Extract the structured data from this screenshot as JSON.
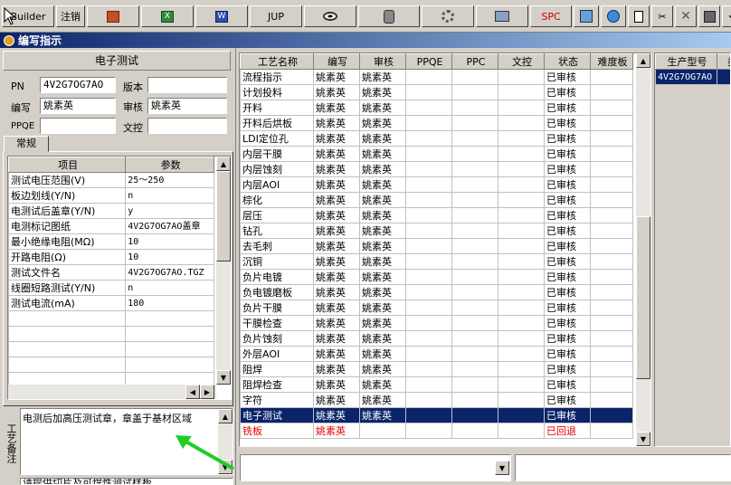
{
  "toolbar": {
    "builder_label": "Builder",
    "logout_label": "注销",
    "jup_label": "JUP",
    "spc_label": "SPC"
  },
  "window": {
    "title": "编写指示"
  },
  "left": {
    "panel_title": "电子测试",
    "pn_label": "PN",
    "pn_value": "4V2G7OG7AO",
    "version_label": "版本",
    "version_value": "",
    "author_label": "编写",
    "author_value": "姚素英",
    "reviewer_label": "审核",
    "reviewer_value": "姚素英",
    "ppqe_label": "PPQE",
    "ppqe_value": "",
    "doc_label": "文控",
    "doc_value": "",
    "tab_general": "常规",
    "params": {
      "col_item": "项目",
      "col_param": "参数",
      "rows": [
        {
          "item": "测试电压范围(V)",
          "param": "25～250"
        },
        {
          "item": "板边划线(Y/N)",
          "param": "n"
        },
        {
          "item": "电测试后盖章(Y/N)",
          "param": "y"
        },
        {
          "item": "电测标记图纸",
          "param": "4V2G7OG7AO盖章"
        },
        {
          "item": "最小绝缘电阻(MΩ)",
          "param": "10"
        },
        {
          "item": "开路电阻(Ω)",
          "param": "10"
        },
        {
          "item": "测试文件名",
          "param": "4V2G7OG7AO.TGZ"
        },
        {
          "item": "线圈短路测试(Y/N)",
          "param": "n"
        },
        {
          "item": "测试电流(mA)",
          "param": "180"
        }
      ]
    },
    "notes_label": "工艺备注",
    "notes_text": "电测后加高压测试章，章盖于基材区域",
    "notes_text2": "请提供切片及可焊性测试样板"
  },
  "process": {
    "columns": [
      "工艺名称",
      "编写",
      "审核",
      "PPQE",
      "PPC",
      "文控",
      "状态",
      "难度板"
    ],
    "rows": [
      {
        "name": "流程指示",
        "author": "姚素英",
        "reviewer": "姚素英",
        "status": "已审核"
      },
      {
        "name": "计划投料",
        "author": "姚素英",
        "reviewer": "姚素英",
        "status": "已审核"
      },
      {
        "name": "开料",
        "author": "姚素英",
        "reviewer": "姚素英",
        "status": "已审核"
      },
      {
        "name": "开料后烘板",
        "author": "姚素英",
        "reviewer": "姚素英",
        "status": "已审核"
      },
      {
        "name": "LDI定位孔",
        "author": "姚素英",
        "reviewer": "姚素英",
        "status": "已审核"
      },
      {
        "name": "内层干膜",
        "author": "姚素英",
        "reviewer": "姚素英",
        "status": "已审核"
      },
      {
        "name": "内层蚀刻",
        "author": "姚素英",
        "reviewer": "姚素英",
        "status": "已审核"
      },
      {
        "name": "内层AOI",
        "author": "姚素英",
        "reviewer": "姚素英",
        "status": "已审核"
      },
      {
        "name": "棕化",
        "author": "姚素英",
        "reviewer": "姚素英",
        "status": "已审核"
      },
      {
        "name": "层压",
        "author": "姚素英",
        "reviewer": "姚素英",
        "status": "已审核"
      },
      {
        "name": "钻孔",
        "author": "姚素英",
        "reviewer": "姚素英",
        "status": "已审核"
      },
      {
        "name": "去毛刺",
        "author": "姚素英",
        "reviewer": "姚素英",
        "status": "已审核"
      },
      {
        "name": "沉铜",
        "author": "姚素英",
        "reviewer": "姚素英",
        "status": "已审核"
      },
      {
        "name": "负片电镀",
        "author": "姚素英",
        "reviewer": "姚素英",
        "status": "已审核"
      },
      {
        "name": "负电镀磨板",
        "author": "姚素英",
        "reviewer": "姚素英",
        "status": "已审核"
      },
      {
        "name": "负片干膜",
        "author": "姚素英",
        "reviewer": "姚素英",
        "status": "已审核"
      },
      {
        "name": "干膜检查",
        "author": "姚素英",
        "reviewer": "姚素英",
        "status": "已审核"
      },
      {
        "name": "负片蚀刻",
        "author": "姚素英",
        "reviewer": "姚素英",
        "status": "已审核"
      },
      {
        "name": "外层AOI",
        "author": "姚素英",
        "reviewer": "姚素英",
        "status": "已审核"
      },
      {
        "name": "阻焊",
        "author": "姚素英",
        "reviewer": "姚素英",
        "status": "已审核"
      },
      {
        "name": "阻焊检查",
        "author": "姚素英",
        "reviewer": "姚素英",
        "status": "已审核"
      },
      {
        "name": "字符",
        "author": "姚素英",
        "reviewer": "姚素英",
        "status": "已审核"
      },
      {
        "name": "电子测试",
        "author": "姚素英",
        "reviewer": "姚素英",
        "status": "已审核"
      },
      {
        "name": "铣板",
        "author": "姚素英",
        "reviewer": "",
        "status": "已回退"
      }
    ]
  },
  "right": {
    "col_model": "生产型号",
    "col_type": "类",
    "model_value": "4V2G7OG7AO"
  },
  "colors": {
    "selection": "#0a246a",
    "rejected": "#e00000",
    "arrow": "#22cc22"
  }
}
